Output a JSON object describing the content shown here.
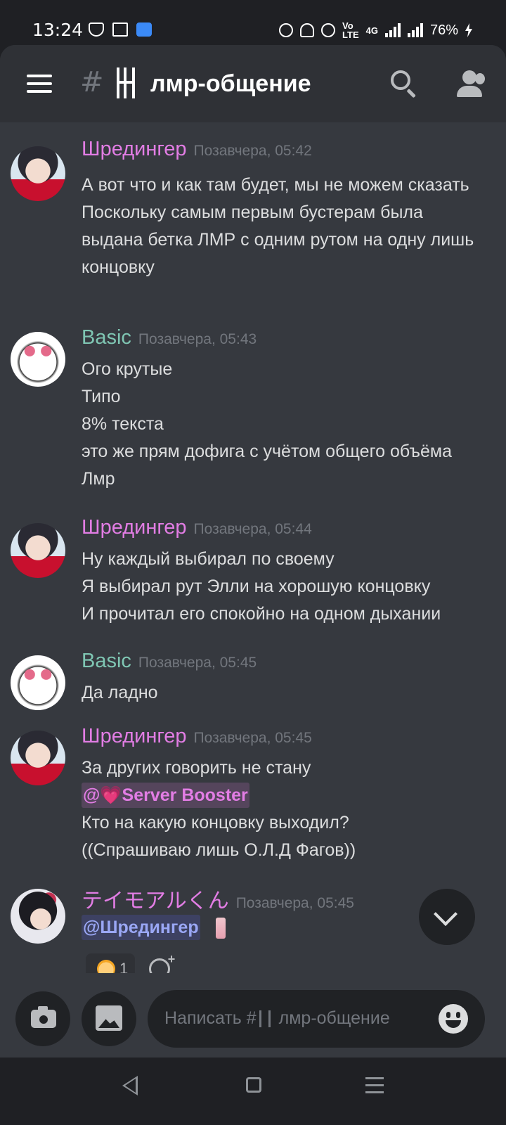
{
  "status_bar": {
    "time": "13:24",
    "net_label_top": "Vo",
    "net_label_bottom": "LTE",
    "net_type": "4G",
    "battery": "76%"
  },
  "header": {
    "channel_prefix": "#",
    "channel_name": "лмр-общение"
  },
  "messages": [
    {
      "author": "Шредингер",
      "timestamp": "Позавчера, 05:42",
      "lines": [
        "А вот что и как там будет, мы не можем сказать",
        "Поскольку самым первым бустерам была выдана бетка ЛМР с одним рутом на одну лишь концовку"
      ]
    },
    {
      "author": "Basic",
      "timestamp": "Позавчера, 05:43",
      "lines": [
        "Ого крутые",
        "Типо",
        "8% текста",
        "это же прям дофига с учётом общего объёма Лмр"
      ]
    },
    {
      "author": "Шредингер",
      "timestamp": "Позавчера, 05:44",
      "lines": [
        "Ну каждый выбирал по своему",
        "Я выбирал рут Элли на хорошую концовку",
        "И прочитал его спокойно на одном дыхании"
      ]
    },
    {
      "author": "Basic",
      "timestamp": "Позавчера, 05:45",
      "lines": [
        "Да ладно"
      ]
    },
    {
      "author": "Шредингер",
      "timestamp": "Позавчера, 05:45",
      "lines": [
        "За других говорить не стану"
      ],
      "mention_at": "@",
      "mention_heart": "💗",
      "mention_role": "Server Booster",
      "after_lines": [
        "Кто на какую концовку выходил?",
        "((Спрашиваю лишь О.Л.Д Фагов))"
      ]
    },
    {
      "author": "テイモアルくん",
      "timestamp": "Позавчера, 05:45",
      "mention_user": "@Шредингер",
      "reaction_count": "1"
    }
  ],
  "composer": {
    "placeholder_prefix": "Написать #",
    "placeholder_channel": "лмр-общение"
  },
  "colors": {
    "author_pink": "#e27de4",
    "author_teal": "#7fc6b3",
    "background": "#36393f",
    "header": "#2f3136"
  }
}
